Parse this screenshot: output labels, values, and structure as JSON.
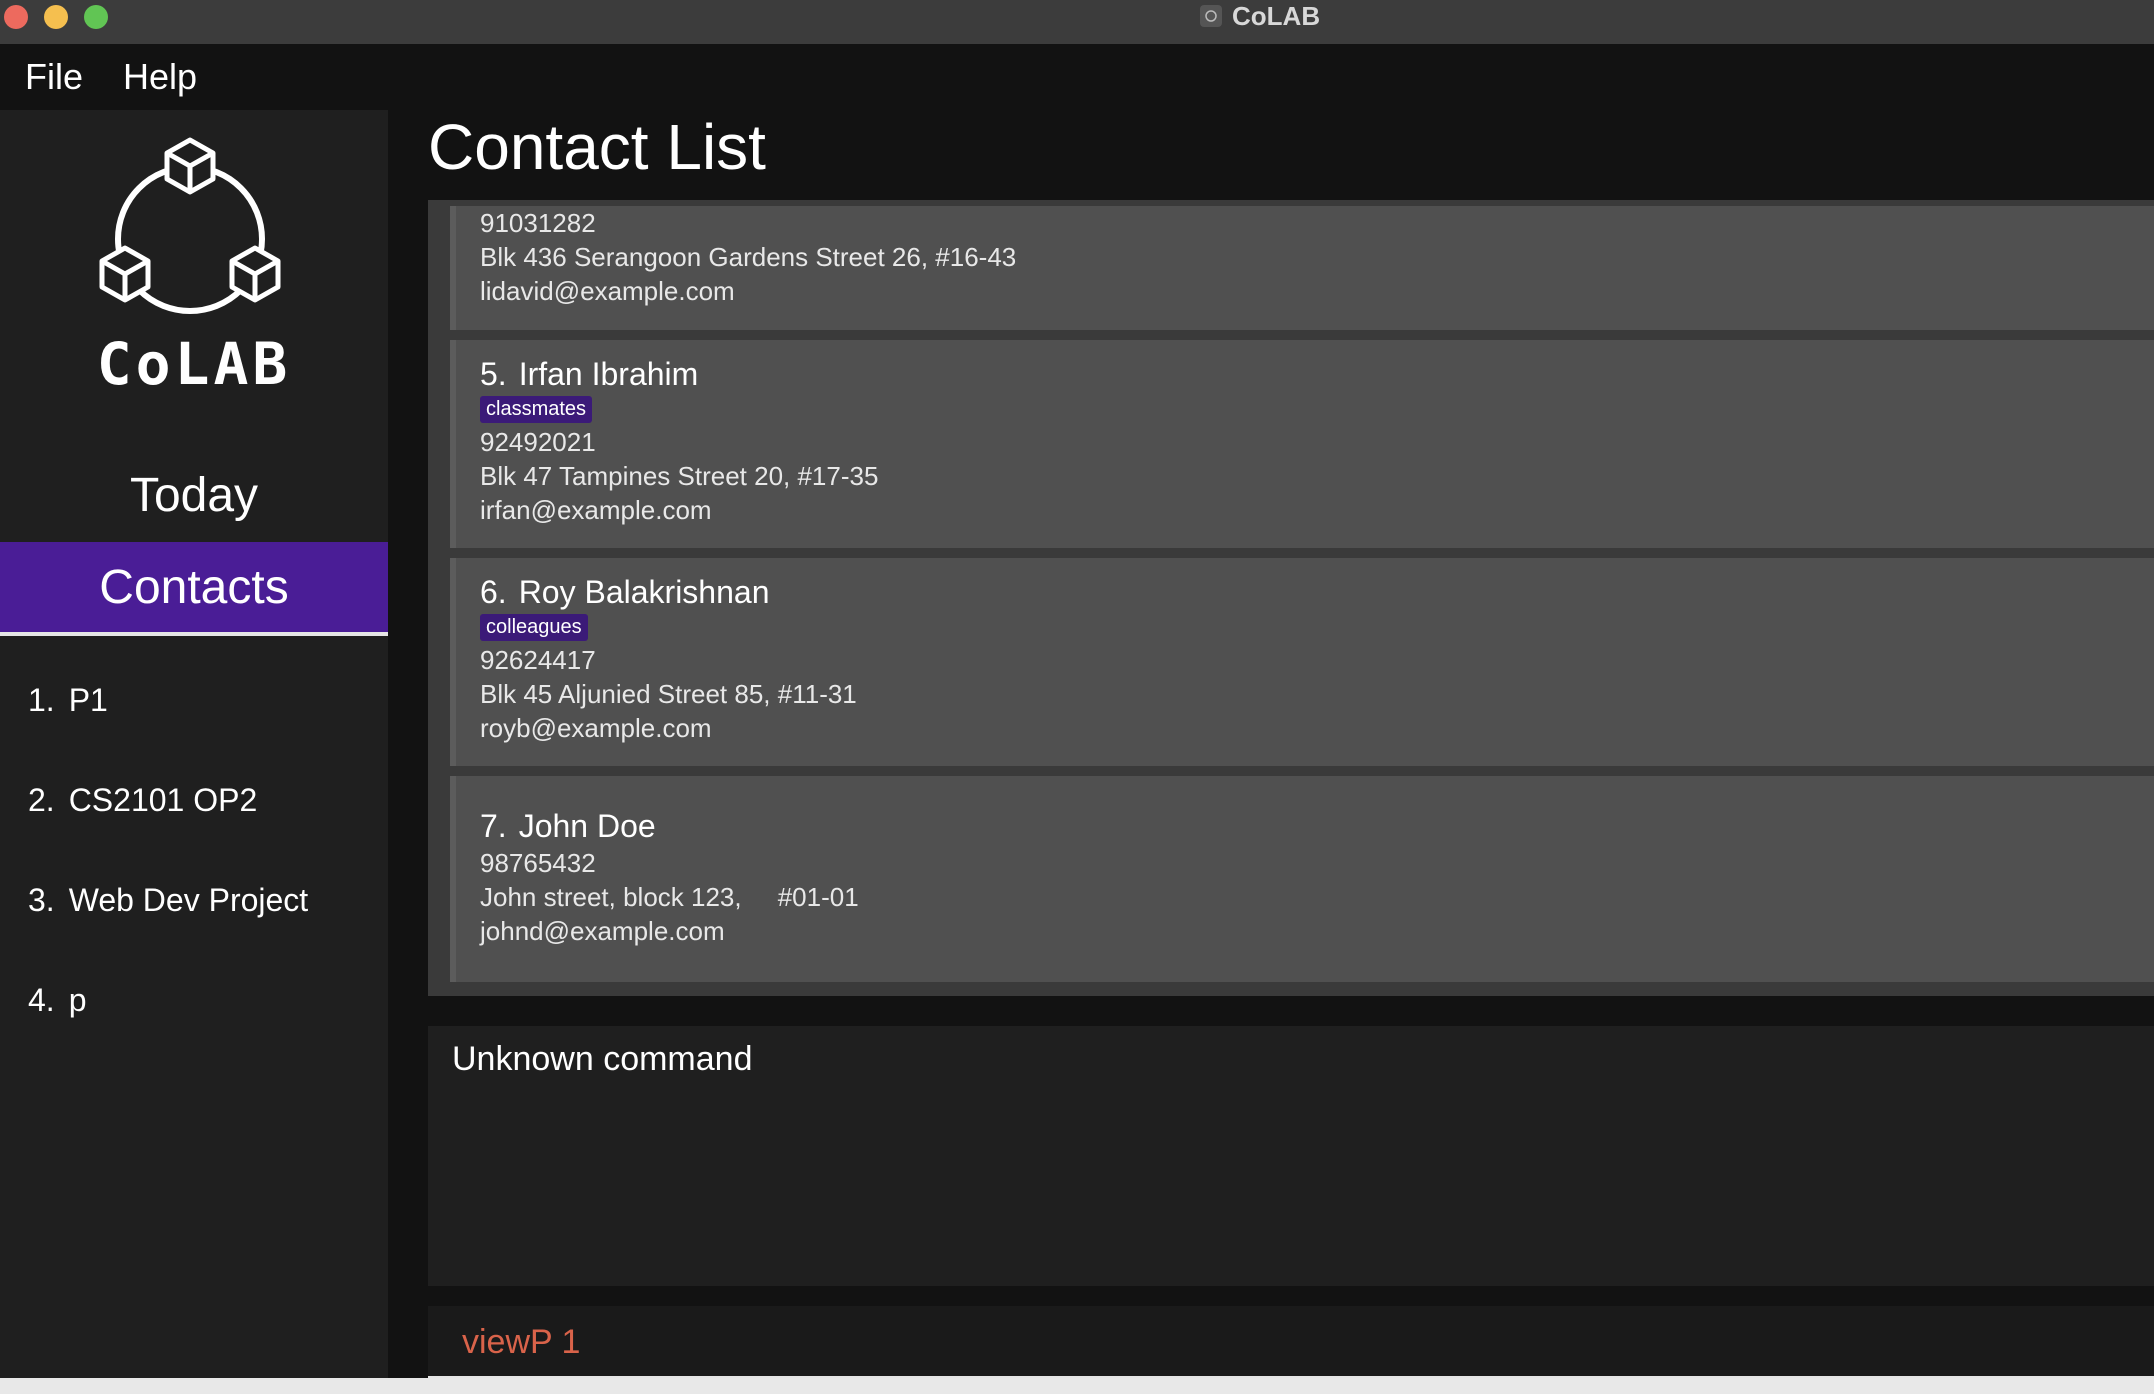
{
  "window": {
    "title": "CoLAB"
  },
  "menu": {
    "file": "File",
    "help": "Help"
  },
  "sidebar": {
    "brand": "CoLAB",
    "nav_today": "Today",
    "nav_contacts": "Contacts",
    "projects": [
      {
        "num": "1.",
        "name": "P1"
      },
      {
        "num": "2.",
        "name": "CS2101 OP2"
      },
      {
        "num": "3.",
        "name": "Web Dev Project"
      },
      {
        "num": "4.",
        "name": "p"
      }
    ]
  },
  "main": {
    "title": "Contact List",
    "contacts": [
      {
        "phone": "91031282",
        "address": "Blk 436 Serangoon Gardens Street 26, #16-43",
        "email": "lidavid@example.com"
      },
      {
        "index": "5.",
        "name": "Irfan Ibrahim",
        "tag": "classmates",
        "phone": "92492021",
        "address": "Blk 47 Tampines Street 20, #17-35",
        "email": "irfan@example.com"
      },
      {
        "index": "6.",
        "name": "Roy Balakrishnan",
        "tag": "colleagues",
        "phone": "92624417",
        "address": "Blk 45 Aljunied Street 85, #11-31",
        "email": "royb@example.com"
      },
      {
        "index": "7.",
        "name": "John Doe",
        "phone": "98765432",
        "address": "John street, block 123,     #01-01",
        "email": "johnd@example.com"
      }
    ],
    "result": "Unknown command",
    "command": {
      "value": "viewP 1"
    }
  },
  "colors": {
    "accent": "#4a1d96",
    "tag_bg": "#3b1a78",
    "command_text": "#d9634a",
    "card_bg": "#505050"
  }
}
